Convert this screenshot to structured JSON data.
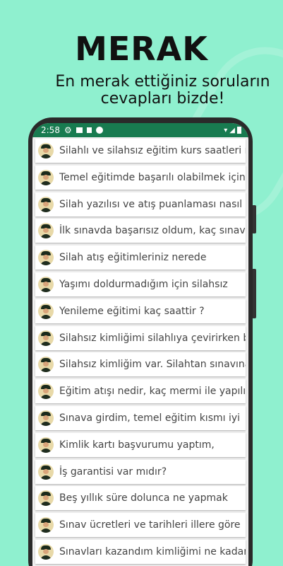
{
  "promo": {
    "title": "MERAK",
    "subtitle": "En merak ettiğiniz soruların cevapları bizde!"
  },
  "status_bar": {
    "time": "2:58"
  },
  "icons": {
    "avatar": "officer-avatar-icon",
    "status": [
      "settings-icon",
      "photo-icon",
      "sim-icon",
      "record-icon",
      "wifi-icon",
      "signal-icon",
      "battery-icon"
    ]
  },
  "colors": {
    "background": "#8ff0cf",
    "status_bar": "#187b50",
    "list_bg": "#f2f2f2"
  },
  "questions": [
    "Silahlı ve silahsız eğitim kurs saatleri ne",
    "Temel eğitimde başarılı olabilmek için",
    "Silah yazılısı ve atış puanlaması nasıl",
    "İlk sınavda başarısız oldum, kaç sınav",
    "Silah atış eğitimleriniz nerede",
    "Yaşımı doldurmadığım için silahsız",
    "Yenileme eğitimi kaç saattir ?",
    "Silahsız kimliğimi silahlıya çevirirken beş",
    "Silahsız kimliğim var. Silahtan sınavına",
    "Eğitim atışı nedir, kaç mermi ile yapılır ?",
    "Sınava girdim, temel eğitim kısmı iyi",
    "Kimlik kartı başvurumu yaptım,",
    "İş garantisi var mıdır?",
    "Beş yıllık süre dolunca ne yapmak",
    "Sınav ücretleri ve tarihleri illere göre",
    "Sınavları kazandım kimliğimi ne kadar"
  ]
}
